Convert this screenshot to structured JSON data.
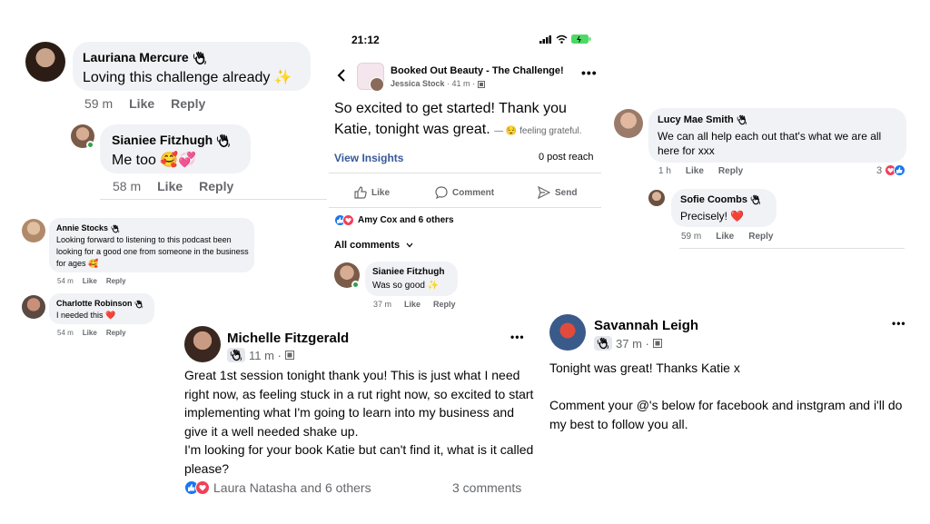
{
  "panel_lauriana": {
    "name": "Lauriana Mercure",
    "text": "Loving this challenge already ✨",
    "time": "59 m",
    "like": "Like",
    "reply": "Reply"
  },
  "panel_sianiee_top": {
    "name": "Sianiee Fitzhugh",
    "text": "Me too 🥰💞",
    "time": "58 m",
    "like": "Like",
    "reply": "Reply"
  },
  "panel_annie": {
    "name": "Annie Stocks",
    "text": "Looking forward to listening to this podcast been looking for a good one from someone in the business for ages 🥰",
    "time": "54 m",
    "like": "Like",
    "reply": "Reply"
  },
  "panel_charlotte": {
    "name": "Charlotte Robinson",
    "text": "I needed this ❤️",
    "time": "54 m",
    "like": "Like",
    "reply": "Reply"
  },
  "phone": {
    "status_time": "21:12",
    "group_name": "Booked Out Beauty - The Challenge!",
    "author": "Jessica Stock",
    "post_time": "41 m",
    "post_text": "So excited to get started! Thank you Katie, tonight was great.",
    "feeling": "— 😌 feeling grateful.",
    "view_insights": "View Insights",
    "post_reach": "0 post reach",
    "action_like": "Like",
    "action_comment": "Comment",
    "action_send": "Send",
    "reactions_text": "Amy Cox and 6 others",
    "all_comments": "All comments",
    "comment_name": "Sianiee Fitzhugh",
    "comment_text": "Was so good ✨",
    "comment_time": "37 m",
    "comment_like": "Like",
    "comment_reply": "Reply"
  },
  "panel_lucy": {
    "name": "Lucy Mae Smith",
    "text": "We can all help each out that's what we are all here for xxx",
    "time": "1 h",
    "like": "Like",
    "reply": "Reply",
    "reaction_count": "3"
  },
  "panel_sofie": {
    "name": "Sofie Coombs",
    "text": "Precisely! ❤️",
    "time": "59 m",
    "like": "Like",
    "reply": "Reply"
  },
  "post_michelle": {
    "name": "Michelle Fitzgerald",
    "time": "11 m ·",
    "text": "Great 1st session tonight thank you! This is just what I need right now, as feeling stuck in a rut right now, so excited to start implementing what I'm going to learn into my business and give it a well needed shake up.\nI'm looking for your book Katie but can't find it, what is it called please?",
    "reactions_text": "Laura Natasha and 6 others",
    "comments_count": "3 comments"
  },
  "post_savannah": {
    "name": "Savannah Leigh",
    "time": "37 m ·",
    "text": "Tonight was great! Thanks Katie x\n\nComment your @'s below for facebook and instgram and i'll do my best to follow you all."
  },
  "colors": {
    "link_blue": "#385898",
    "bubble_gray": "#f0f2f5",
    "meta_gray": "#65676b",
    "like_blue": "#1877f2",
    "love_red": "#f33e58",
    "online_green": "#31a24c"
  },
  "icons": [
    "wave-hand-badge-icon",
    "back-chevron-icon",
    "more-dots-icon",
    "like-thumb-icon",
    "comment-icon",
    "send-icon",
    "chevron-down-icon",
    "signal-icon",
    "wifi-icon",
    "battery-icon",
    "privacy-group-icon"
  ]
}
